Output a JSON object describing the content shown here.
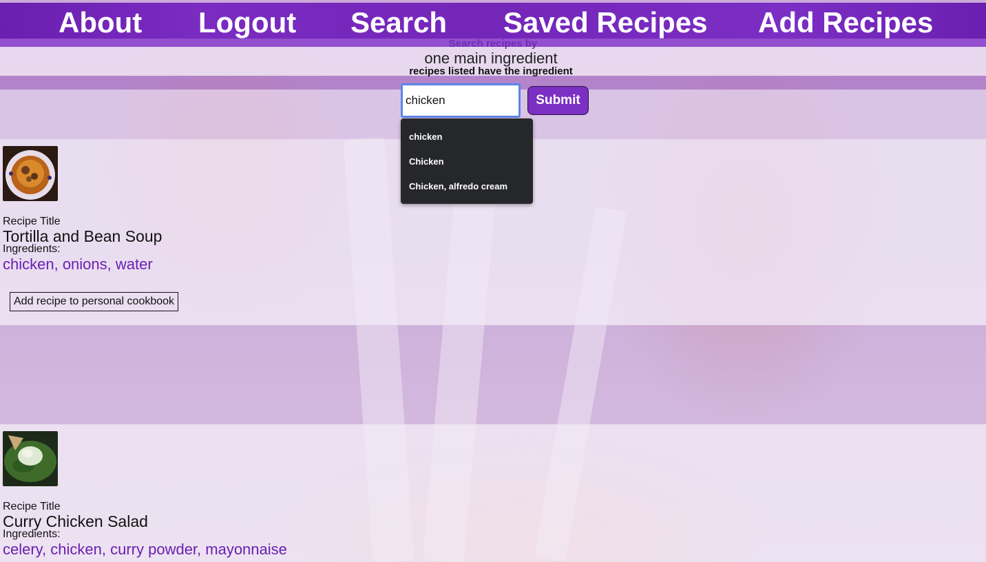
{
  "nav": {
    "about": "About",
    "logout": "Logout",
    "search": "Search",
    "saved": "Saved Recipes",
    "add": "Add Recipes"
  },
  "search": {
    "title": "Search recipes by",
    "subtitle": "one main ingredient",
    "note": "recipes listed have the ingredient",
    "input_value": "chicken",
    "submit_label": "Submit",
    "suggestions": [
      "chicken",
      "Chicken",
      "Chicken, alfredo cream"
    ]
  },
  "recipes": [
    {
      "title_label": "Recipe Title",
      "title": "Tortilla and Bean Soup",
      "ingredients_label": "Ingredients:",
      "ingredients": "chicken, onions, water",
      "add_label": "Add recipe to personal cookbook"
    },
    {
      "title_label": "Recipe Title",
      "title": "Curry Chicken Salad",
      "ingredients_label": "Ingredients:",
      "ingredients": "celery, chicken, curry powder, mayonnaise"
    }
  ],
  "colors": {
    "nav": "#7426b9",
    "accent": "#6a1fb3",
    "submit": "#7b2fc3",
    "input_focus": "#5a86e8",
    "dropdown": "#26272b"
  }
}
